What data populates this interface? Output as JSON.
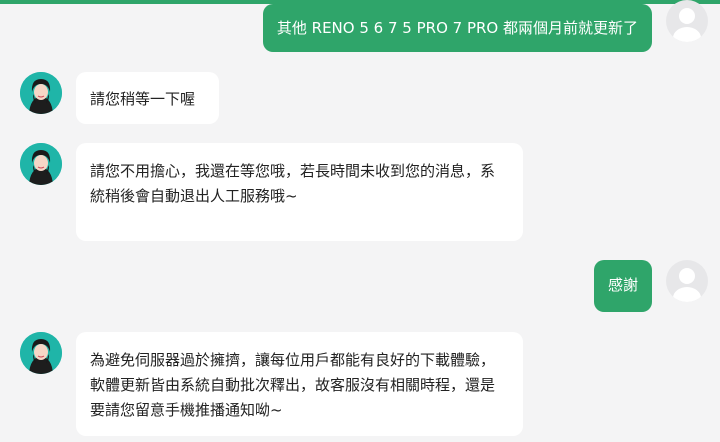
{
  "conversation": {
    "messages": [
      {
        "sender": "user",
        "text": "其他 RENO 5 6 7 5 PRO 7 PRO 都兩個月前就更新了",
        "avatar_icon": "user-default-avatar-icon"
      },
      {
        "sender": "agent",
        "text": "請您稍等一下喔",
        "avatar_icon": "agent-avatar-icon"
      },
      {
        "sender": "agent",
        "text": "請您不用擔心，我還在等您哦，若長時間未收到您的消息，系統稍後會自動退出人工服務哦~",
        "avatar_icon": "agent-avatar-icon"
      },
      {
        "sender": "user",
        "text": "感謝",
        "avatar_icon": "user-default-avatar-icon"
      },
      {
        "sender": "agent",
        "text": "為避免伺服器過於擁擠，讓每位用戶都能有良好的下載體驗，軟體更新皆由系統自動批次釋出，故客服沒有相關時程，還是要請您留意手機推播通知呦~",
        "avatar_icon": "agent-avatar-icon"
      }
    ]
  },
  "colors": {
    "accent": "#2fa56a",
    "background": "#f4f4f5",
    "agent_bubble": "#ffffff",
    "agent_avatar": "#1fb5a8",
    "user_avatar": "#e7e7e9"
  }
}
